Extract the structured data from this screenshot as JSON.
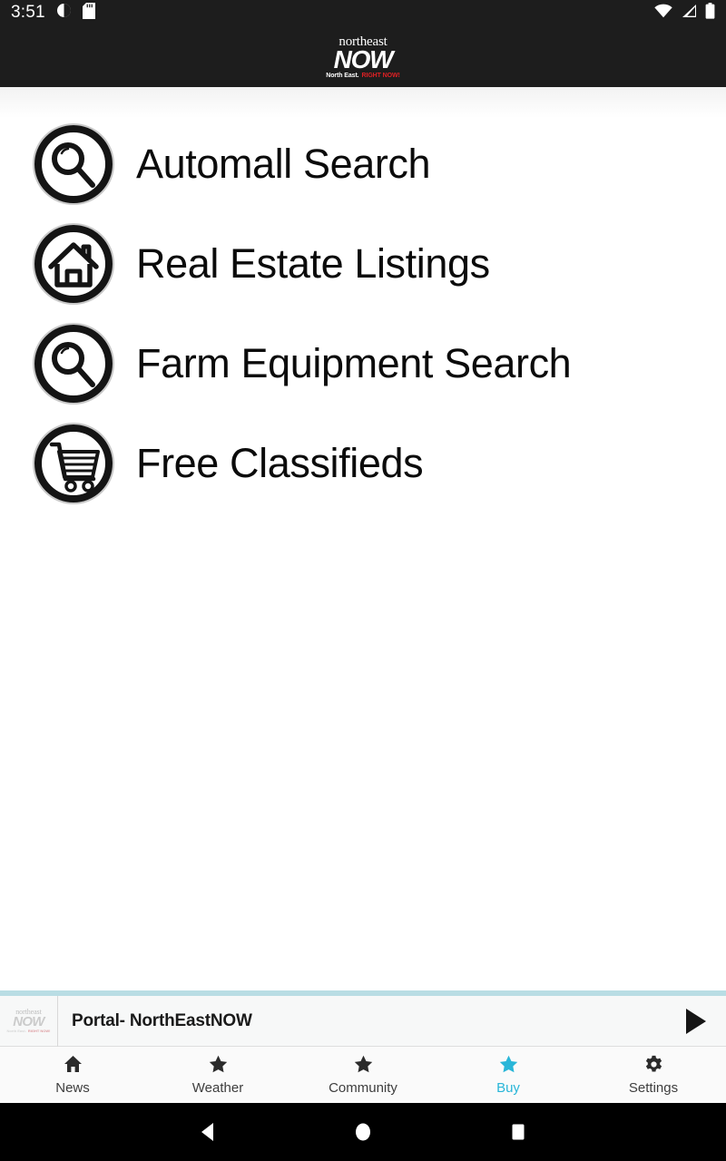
{
  "status_bar": {
    "time": "3:51",
    "left_icons": [
      "do-not-disturb-icon",
      "sd-card-icon"
    ],
    "right_icons": [
      "wifi-icon",
      "cellular-signal-icon",
      "battery-icon"
    ]
  },
  "app_bar": {
    "brand_top": "northeast",
    "brand_main": "NOW",
    "tagline_white": "North East.",
    "tagline_red": "RIGHT NOW!",
    "background_color": "#1d1d1d"
  },
  "menu": {
    "items": [
      {
        "label": "Automall Search",
        "icon": "magnifier-circle-icon"
      },
      {
        "label": "Real Estate Listings",
        "icon": "house-circle-icon"
      },
      {
        "label": "Farm Equipment Search",
        "icon": "magnifier-circle-icon"
      },
      {
        "label": "Free Classifieds",
        "icon": "shopping-cart-circle-icon"
      }
    ]
  },
  "player": {
    "title": "Portal- NorthEastNOW",
    "thumb_top": "northeast",
    "thumb_main": "NOW",
    "thumb_tag_1": "North East.",
    "thumb_tag_2": "RIGHT NOW!",
    "play_icon": "play-icon",
    "accent_color": "#b9dde4"
  },
  "bottom_nav": {
    "active_color": "#29b6d8",
    "items": [
      {
        "label": "News",
        "icon": "home-icon",
        "active": false
      },
      {
        "label": "Weather",
        "icon": "star-icon",
        "active": false
      },
      {
        "label": "Community",
        "icon": "star-icon",
        "active": false
      },
      {
        "label": "Buy",
        "icon": "star-icon",
        "active": true
      },
      {
        "label": "Settings",
        "icon": "gear-icon",
        "active": false
      }
    ]
  },
  "system_nav": {
    "back": "back-triangle-icon",
    "home": "home-circle-icon",
    "recents": "recents-square-icon"
  }
}
